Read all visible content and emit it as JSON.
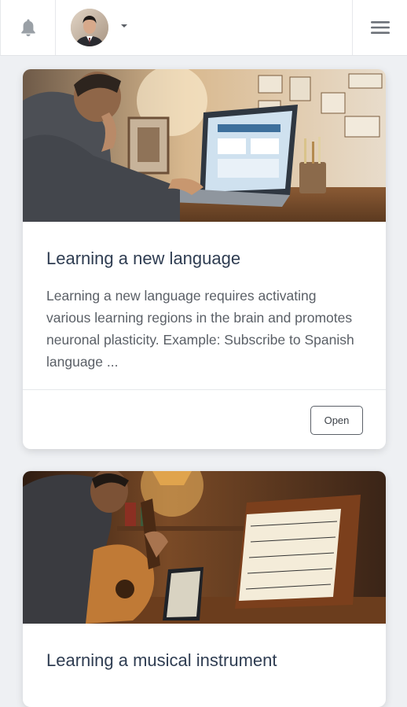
{
  "header": {
    "notifications_icon": "bell-icon",
    "avatar_icon": "user-avatar",
    "menu_icon": "hamburger-menu-icon"
  },
  "cards": [
    {
      "title": "Learning a new language",
      "text": "Learning a new language requires activating various learning regions in the brain and promotes neuronal plasticity. Example: Subscribe to Spanish language ...",
      "button": "Open"
    },
    {
      "title": "Learning a musical instrument"
    }
  ]
}
